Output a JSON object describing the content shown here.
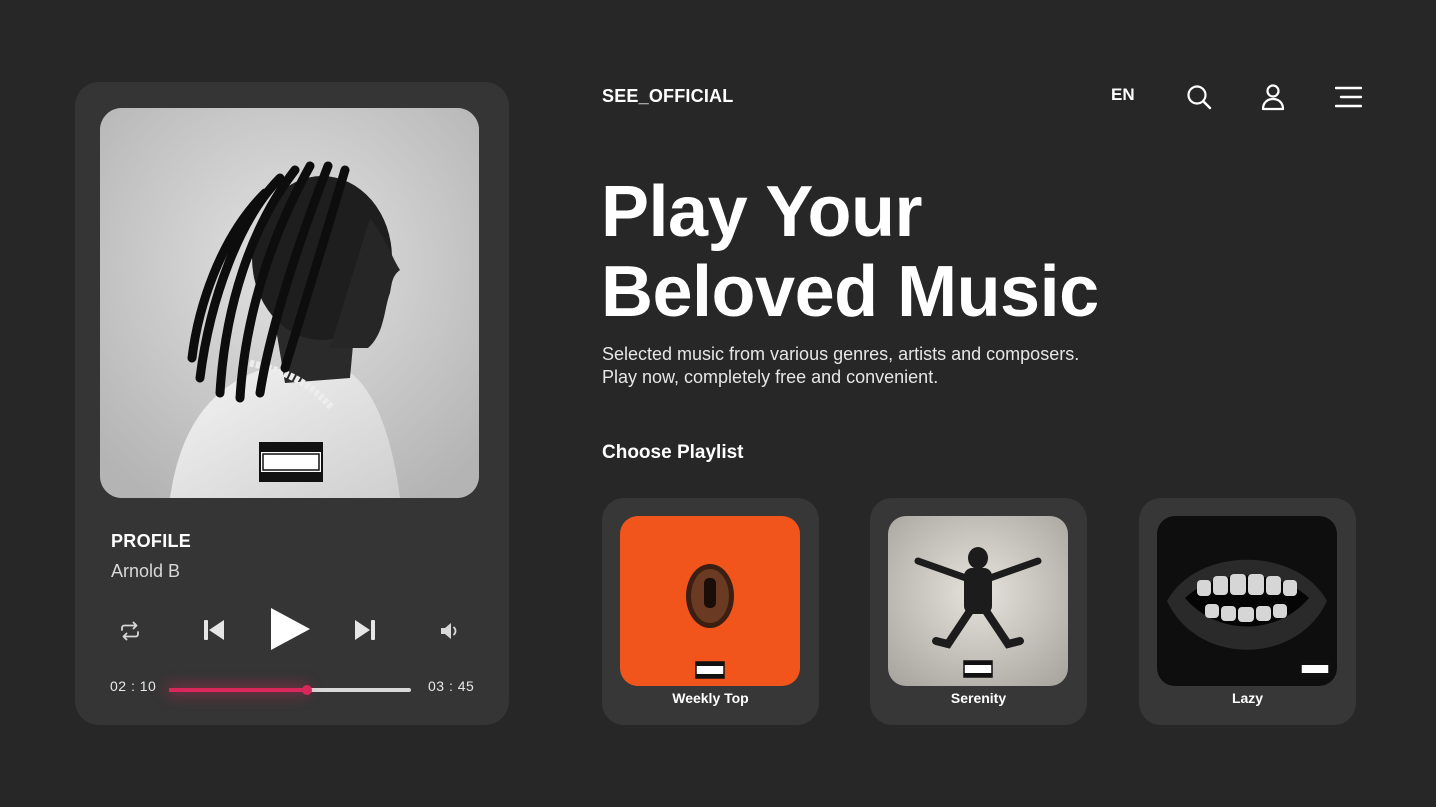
{
  "header": {
    "brand": "SEE_OFFICIAL",
    "language": "EN",
    "icons": [
      "search-icon",
      "user-icon",
      "menu-icon"
    ]
  },
  "hero": {
    "title_line1": "Play Your",
    "title_line2": "Beloved Music",
    "subtitle_line1": "Selected music from various genres, artists and composers.",
    "subtitle_line2": "Play now, completely free and convenient."
  },
  "playlists": {
    "heading": "Choose Playlist",
    "items": [
      {
        "label": "Weekly Top",
        "cover_color": "#f2551b"
      },
      {
        "label": "Serenity",
        "cover_color": "#d6d3cc"
      },
      {
        "label": "Lazy",
        "cover_color": "#111111"
      }
    ]
  },
  "player": {
    "track_title": "PROFILE",
    "artist": "Arnold B",
    "current_time": "02 : 10",
    "total_time": "03 : 45",
    "progress": 0.57,
    "accent_color": "#d9275b",
    "cover_badge": [
      "PARENTAL",
      "ADVISORY",
      "EXPLICIT CONTENT"
    ],
    "controls": [
      "repeat-icon",
      "previous-icon",
      "play-icon",
      "next-icon",
      "volume-icon"
    ]
  },
  "colors": {
    "background": "#272727",
    "card": "#353535",
    "accent": "#d9275b"
  }
}
